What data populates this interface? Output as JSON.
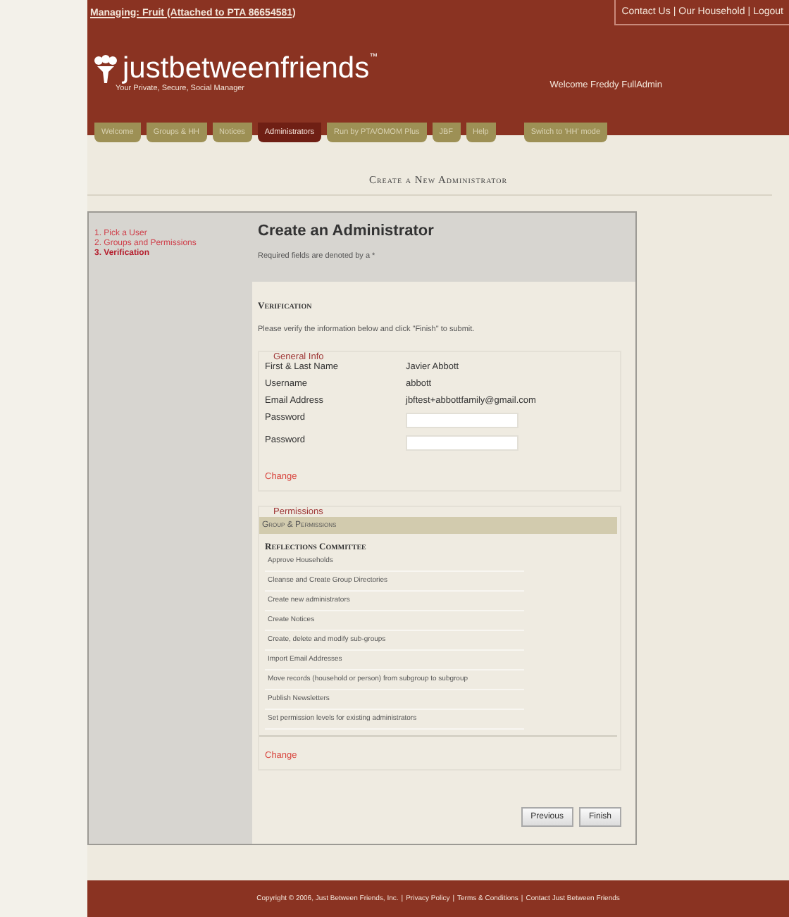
{
  "top_bar": {
    "managing_link": "Managing: Fruit (Attached to PTA 86654581)",
    "links": [
      "Contact Us",
      "Our Household",
      "Logout"
    ],
    "separator": "|"
  },
  "logo": {
    "name": "justbetweenfriends",
    "tm": "™",
    "tagline": "Your Private, Secure, Social Manager"
  },
  "welcome": "Welcome Freddy FullAdmin",
  "tabs": [
    {
      "label": "Welcome",
      "selected": false
    },
    {
      "label": "Groups & HH",
      "selected": false
    },
    {
      "label": "Notices",
      "selected": false
    },
    {
      "label": "Administrators",
      "selected": true
    },
    {
      "label": "Run by PTA/OMOM Plus",
      "selected": false
    },
    {
      "label": "JBF",
      "selected": false
    },
    {
      "label": "Help",
      "selected": false
    },
    {
      "label": "Switch to 'HH' mode",
      "selected": false
    }
  ],
  "page_title": "Create a New Administrator",
  "steps": [
    {
      "label": "1. Pick a User",
      "selected": false
    },
    {
      "label": "2. Groups and Permissions",
      "selected": false
    },
    {
      "label": "3. Verification",
      "selected": true
    }
  ],
  "form": {
    "title": "Create an Administrator",
    "required_note": "Required fields are denoted by a *",
    "section": "Verification",
    "instructions": "Please verify the information below and click \"Finish\" to submit.",
    "general_info": {
      "legend": "General Info",
      "rows": [
        {
          "kind": "text",
          "label": "First & Last Name",
          "value": "Javier Abbott"
        },
        {
          "kind": "text",
          "label": "Username",
          "value": "abbott"
        },
        {
          "kind": "text",
          "label": "Email Address",
          "value": "jbftest+abbottfamily@gmail.com"
        },
        {
          "kind": "input",
          "label": "Password"
        },
        {
          "kind": "input",
          "label": "Password"
        }
      ],
      "change_link": "Change"
    },
    "permissions": {
      "legend": "Permissions",
      "header": "Group & Permissions",
      "group": "Reflections Committee",
      "items": [
        "Approve Households",
        "Cleanse and Create Group Directories",
        "Create new administrators",
        "Create Notices",
        "Create, delete and modify sub-groups",
        "Import Email Addresses",
        "Move records (household or person) from subgroup to subgroup",
        "Publish Newsletters",
        "Set permission levels for existing administrators"
      ],
      "change_link": "Change"
    },
    "buttons": [
      "Previous",
      "Finish"
    ]
  },
  "footer": {
    "copyright": "Copyright © 2006, Just Between Friends, Inc.",
    "links": [
      "Privacy Policy",
      "Terms & Conditions",
      "Contact Just Between Friends"
    ],
    "separator": "|"
  }
}
